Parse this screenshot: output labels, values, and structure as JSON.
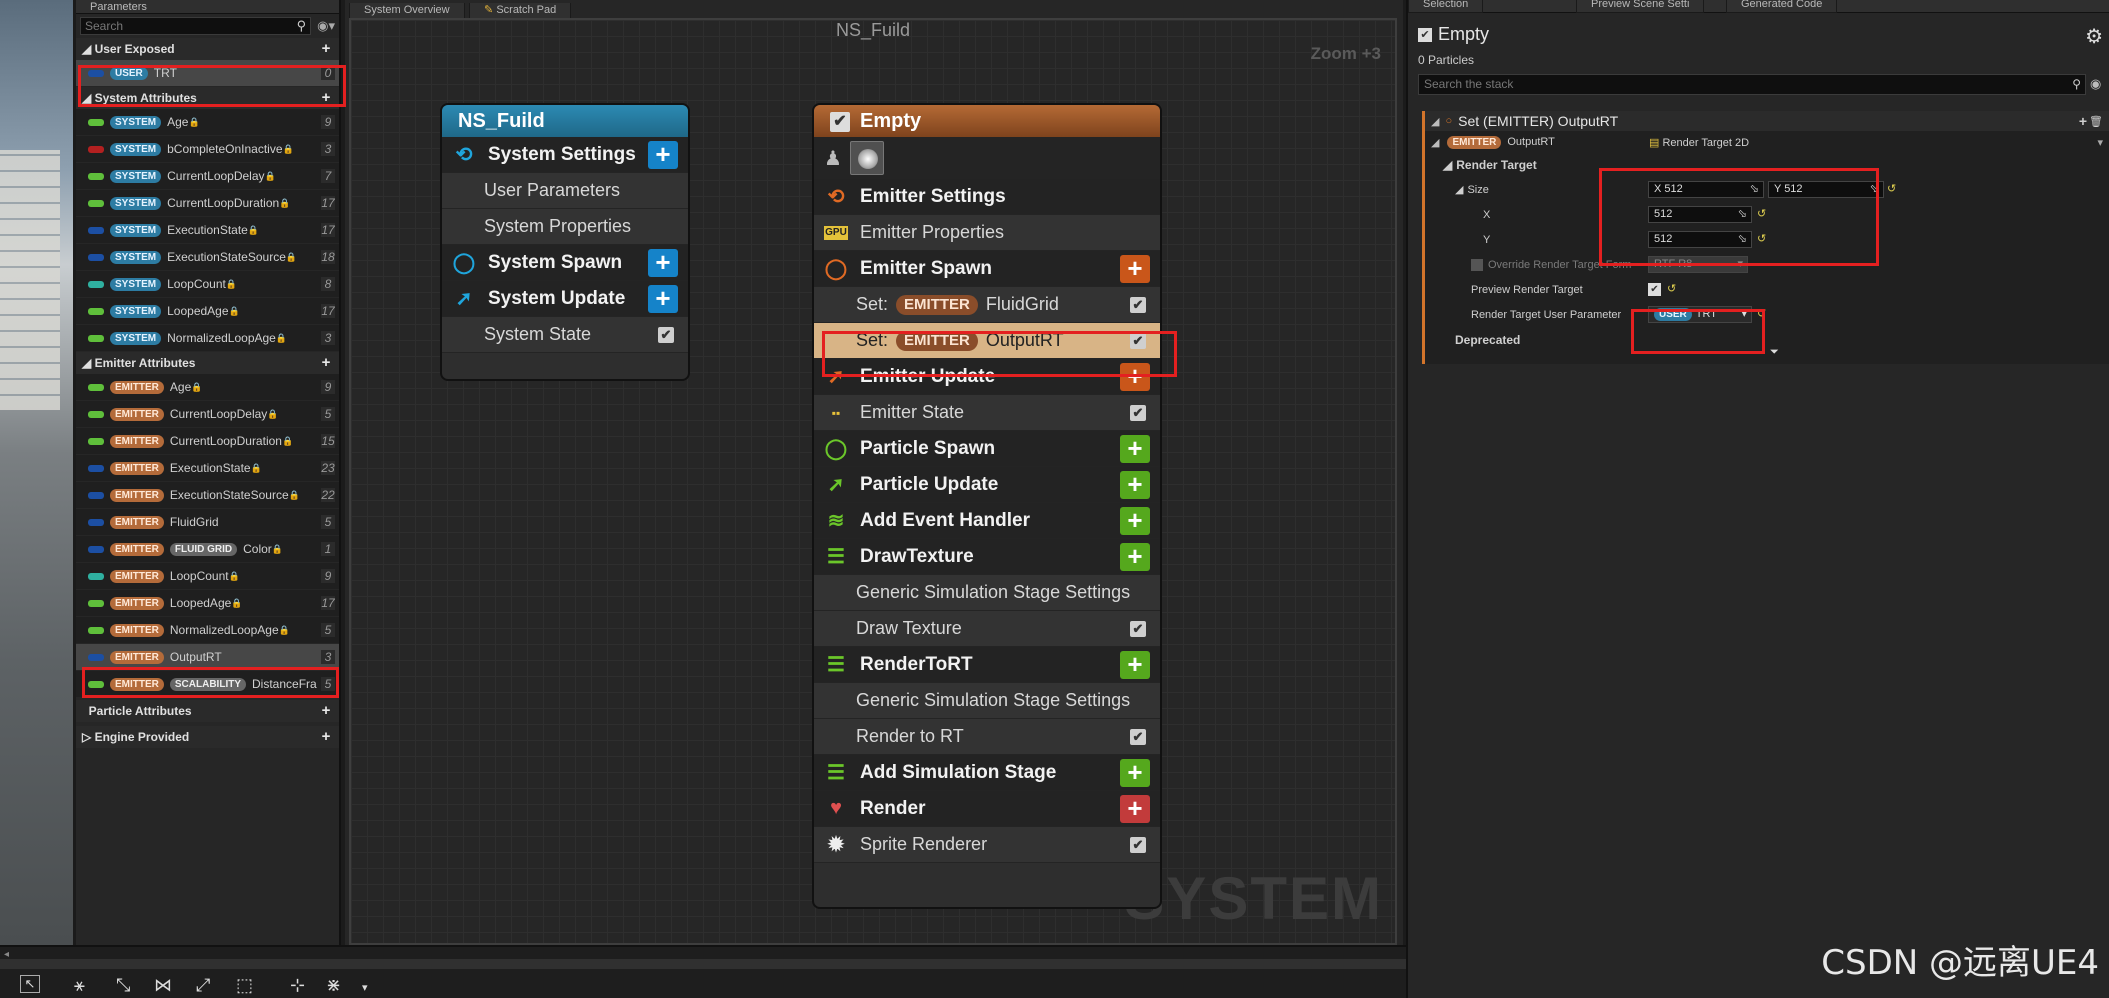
{
  "params_panel": {
    "tab": "Parameters",
    "search_placeholder": "Search",
    "user_exposed": {
      "title": "User Exposed",
      "items": [
        {
          "badge": "USER",
          "name": "TRT",
          "count": "0"
        }
      ]
    },
    "system_attributes": {
      "title": "System Attributes",
      "items": [
        {
          "badge": "SYSTEM",
          "name": "Age",
          "count": "9",
          "pill": "#5fbf3b",
          "lock": true
        },
        {
          "badge": "SYSTEM",
          "name": "bCompleteOnInactive",
          "count": "3",
          "pill": "#b32020",
          "lock": true
        },
        {
          "badge": "SYSTEM",
          "name": "CurrentLoopDelay",
          "count": "7",
          "pill": "#5fbf3b",
          "lock": true
        },
        {
          "badge": "SYSTEM",
          "name": "CurrentLoopDuration",
          "count": "17",
          "pill": "#5fbf3b",
          "lock": true
        },
        {
          "badge": "SYSTEM",
          "name": "ExecutionState",
          "count": "17",
          "pill": "#1c4fa3",
          "lock": true
        },
        {
          "badge": "SYSTEM",
          "name": "ExecutionStateSource",
          "count": "18",
          "pill": "#1c4fa3",
          "lock": true
        },
        {
          "badge": "SYSTEM",
          "name": "LoopCount",
          "count": "8",
          "pill": "#2fb0a0",
          "lock": true
        },
        {
          "badge": "SYSTEM",
          "name": "LoopedAge",
          "count": "17",
          "pill": "#5fbf3b",
          "lock": true
        },
        {
          "badge": "SYSTEM",
          "name": "NormalizedLoopAge",
          "count": "3",
          "pill": "#5fbf3b",
          "lock": true
        }
      ]
    },
    "emitter_attributes": {
      "title": "Emitter Attributes",
      "items": [
        {
          "badge": "EMITTER",
          "name": "Age",
          "count": "9",
          "pill": "#5fbf3b",
          "lock": true
        },
        {
          "badge": "EMITTER",
          "name": "CurrentLoopDelay",
          "count": "5",
          "pill": "#5fbf3b",
          "lock": true
        },
        {
          "badge": "EMITTER",
          "name": "CurrentLoopDuration",
          "count": "15",
          "pill": "#5fbf3b",
          "lock": true
        },
        {
          "badge": "EMITTER",
          "name": "ExecutionState",
          "count": "23",
          "pill": "#1c4fa3",
          "lock": true
        },
        {
          "badge": "EMITTER",
          "name": "ExecutionStateSource",
          "count": "22",
          "pill": "#1c4fa3",
          "lock": true
        },
        {
          "badge": "EMITTER",
          "name": "FluidGrid",
          "count": "5",
          "pill": "#1c4fa3",
          "lock": false
        },
        {
          "badge": "EMITTER",
          "badge2": "FLUID GRID",
          "name": "Color",
          "count": "1",
          "pill": "#1c4fa3",
          "lock": true
        },
        {
          "badge": "EMITTER",
          "name": "LoopCount",
          "count": "9",
          "pill": "#2fb0a0",
          "lock": true
        },
        {
          "badge": "EMITTER",
          "name": "LoopedAge",
          "count": "17",
          "pill": "#5fbf3b",
          "lock": true
        },
        {
          "badge": "EMITTER",
          "name": "NormalizedLoopAge",
          "count": "5",
          "pill": "#5fbf3b",
          "lock": true
        },
        {
          "badge": "EMITTER",
          "name": "OutputRT",
          "count": "3",
          "pill": "#1c4fa3",
          "lock": false
        },
        {
          "badge": "EMITTER",
          "badge2": "SCALABILITY",
          "name": "DistanceFra",
          "count": "5",
          "pill": "#5fbf3b",
          "lock": false
        }
      ]
    },
    "particle_attributes": "Particle Attributes",
    "engine_provided": "Engine Provided"
  },
  "graph": {
    "tabs": [
      "System Overview",
      "Scratch Pad"
    ],
    "title": "NS_Fuild",
    "zoom": "Zoom +3",
    "watermark": "SYSTEM",
    "system_node": {
      "title": "NS_Fuild",
      "rows": [
        {
          "label": "System Settings",
          "kind": "big"
        },
        {
          "label": "User Parameters",
          "kind": "sub"
        },
        {
          "label": "System Properties",
          "kind": "sub"
        },
        {
          "label": "System Spawn",
          "kind": "big"
        },
        {
          "label": "System Update",
          "kind": "big"
        },
        {
          "label": "System State",
          "kind": "sub"
        }
      ]
    },
    "emitter_node": {
      "title": "Empty",
      "rows": [
        {
          "label": "Emitter Settings"
        },
        {
          "label": "Emitter Properties",
          "icon": "GPU"
        },
        {
          "label": "Emitter Spawn"
        },
        {
          "label": "FluidGrid",
          "prefix": "Set:",
          "badge": "EMITTER"
        },
        {
          "label": "OutputRT",
          "prefix": "Set:",
          "badge": "EMITTER"
        },
        {
          "label": "Emitter Update"
        },
        {
          "label": "Emitter State"
        },
        {
          "label": "Particle Spawn"
        },
        {
          "label": "Particle Update"
        },
        {
          "label": "Add Event Handler"
        },
        {
          "label": "DrawTexture"
        },
        {
          "label": "Generic Simulation Stage Settings"
        },
        {
          "label": "Draw Texture"
        },
        {
          "label": "RenderToRT"
        },
        {
          "label": "Generic Simulation Stage Settings"
        },
        {
          "label": "Render to RT"
        },
        {
          "label": "Add Simulation Stage"
        },
        {
          "label": "Render"
        },
        {
          "label": "Sprite Renderer"
        }
      ]
    }
  },
  "selection_panel": {
    "tabs": [
      "Selection",
      "Preview Scene Setti",
      "Generated Code"
    ],
    "emitter_name": "Empty",
    "particles": "0 Particles",
    "search_placeholder": "Search the stack",
    "module_title": "Set (EMITTER) OutputRT",
    "param_badge": "EMITTER",
    "param_name": "OutputRT",
    "param_type": "Render Target 2D",
    "render_target": "Render Target",
    "size_label": "Size",
    "size_x": "X 512",
    "size_y": "Y 512",
    "x_label": "X",
    "x_value": "512",
    "y_label": "Y",
    "y_value": "512",
    "override_label": "Override Render Target Form",
    "override_value": "RTF R8",
    "preview_label": "Preview Render Target",
    "user_param_label": "Render Target User Parameter",
    "user_param_badge": "USER",
    "user_param_value": "TRT",
    "deprecated": "Deprecated"
  },
  "watermark_csdn": "CSDN @远离UE4"
}
